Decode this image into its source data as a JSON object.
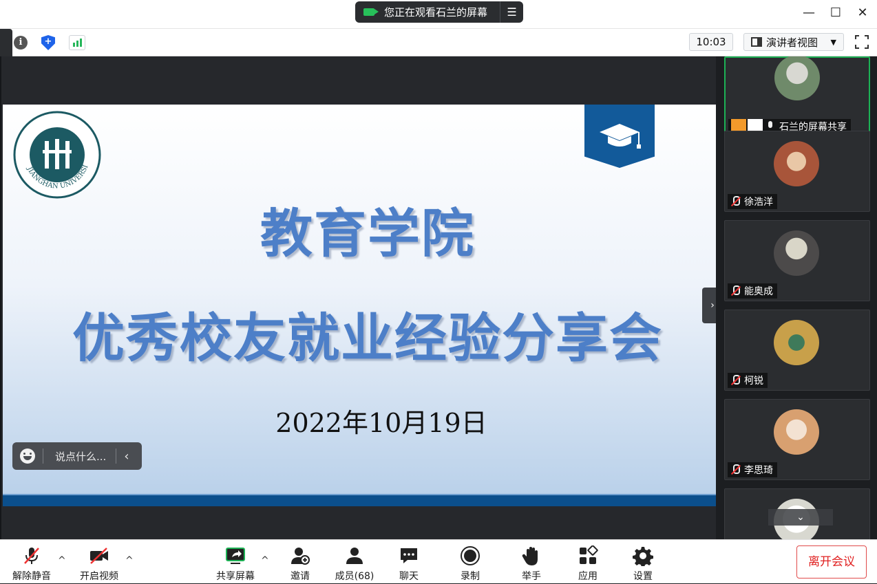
{
  "titlebar": {
    "share_banner_text": "您正在观看石兰的屏幕",
    "minimize": "—",
    "maximize": "☐",
    "close": "✕"
  },
  "toolbar": {
    "time": "10:03",
    "view_mode": "演讲者视图",
    "view_caret": "▼"
  },
  "slide": {
    "logo_text": "JIANGHAN UNIVERSITY",
    "title_line1": "教育学院",
    "title_line2": "优秀校友就业经验分享会",
    "date": "2022年10月19日"
  },
  "chat": {
    "placeholder": "说点什么...",
    "collapse_arrow": "‹"
  },
  "stage": {
    "collapse_arrow": "›"
  },
  "participants": [
    {
      "name": "石兰的屏幕共享",
      "avatar_color": "#6f8a6a",
      "active": true
    },
    {
      "name": "徐浩洋",
      "avatar_color": "#a8553a"
    },
    {
      "name": "能奥成",
      "avatar_color": "#4c4a4a"
    },
    {
      "name": "柯锐",
      "avatar_color": "#c8a04a"
    },
    {
      "name": "李思琦",
      "avatar_color": "#e8c8a8"
    }
  ],
  "sidebar": {
    "scroll_down": "⌄"
  },
  "controls": {
    "unmute": "解除静音",
    "start_video": "开启视频",
    "share_screen": "共享屏幕",
    "invite": "邀请",
    "members": "成员(68)",
    "chat": "聊天",
    "record": "录制",
    "raise_hand": "举手",
    "apps": "应用",
    "settings": "设置",
    "leave": "离开会议",
    "caret": "^"
  },
  "colors": {
    "accent_green": "#1db255",
    "slide_title": "#4d7fc8",
    "leave_red": "#e02020"
  }
}
